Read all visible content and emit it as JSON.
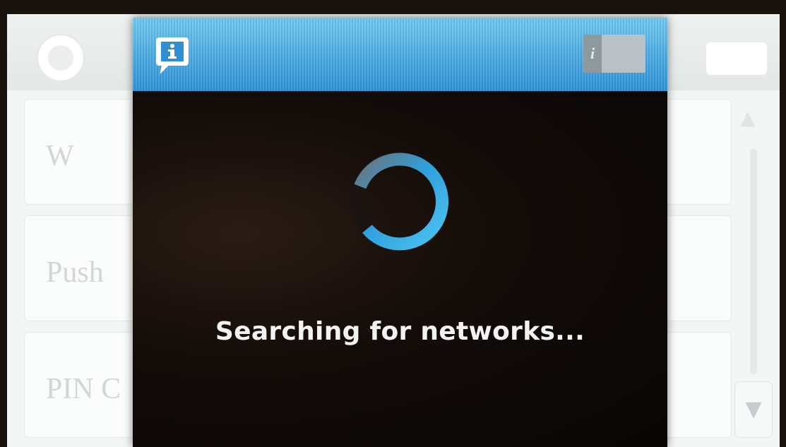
{
  "background_screen": {
    "rows": [
      {
        "label": "W"
      },
      {
        "label": "Push"
      },
      {
        "label": "PIN C"
      }
    ],
    "scroll_up_glyph": "▲",
    "scroll_down_glyph": "▼"
  },
  "dialog": {
    "title_icon": "info-bubble-icon",
    "info_toggle_label": "i",
    "status_text": "Searching for networks...",
    "spinner_icon": "loading-spinner-icon",
    "colors": {
      "titlebar_top": "#6ec7ee",
      "titlebar_bottom": "#2a90d6",
      "spinner_accent": "#3fb6ea",
      "background": "#0d0907"
    }
  }
}
